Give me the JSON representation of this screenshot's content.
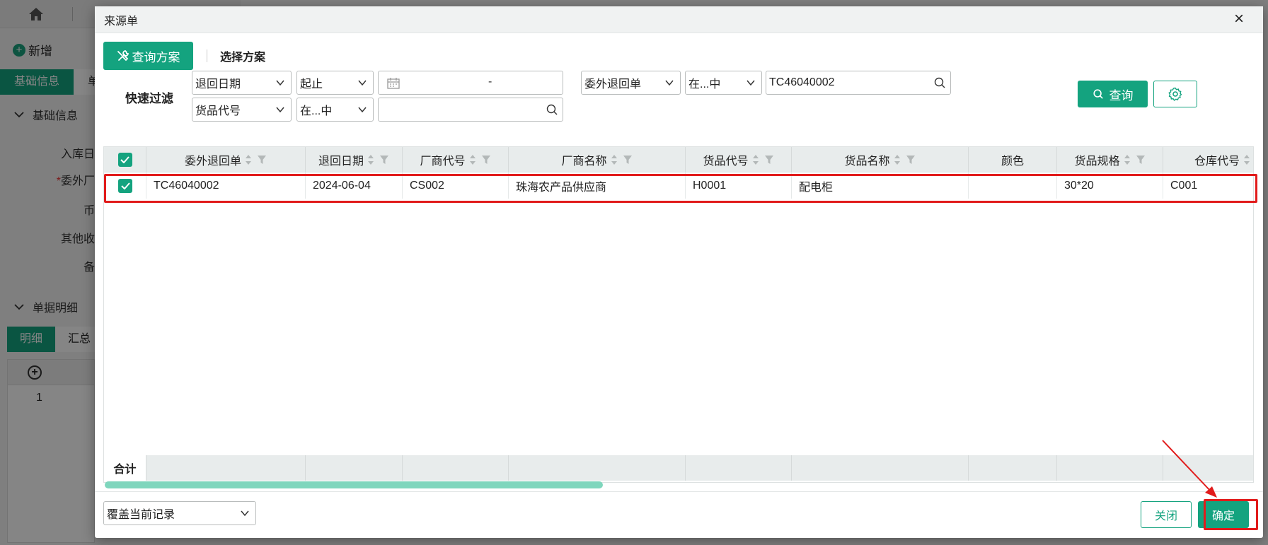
{
  "background": {
    "toolbar": {
      "add_label": "新增"
    },
    "tabs": [
      "基础信息",
      "单"
    ],
    "section_basic": "基础信息",
    "labels": [
      "入库日",
      "委外厂",
      "币",
      "其他收",
      "备"
    ],
    "section_detail": "单据明细",
    "subtabs": [
      "明细",
      "汇总"
    ],
    "grid_row_number": "1"
  },
  "modal": {
    "title": "来源单",
    "scheme_button": "查询方案",
    "scheme_select": "选择方案",
    "filter": {
      "title": "快速过滤",
      "row1": {
        "field1": "退回日期",
        "op1": "起止",
        "date_separator": "-",
        "field2": "委外退回单",
        "op2": "在...中",
        "value2": "TC46040002"
      },
      "row2": {
        "field1": "货品代号",
        "op1": "在...中",
        "value1": ""
      }
    },
    "query_button": "查询",
    "grid": {
      "columns": [
        "委外退回单",
        "退回日期",
        "厂商代号",
        "厂商名称",
        "货品代号",
        "货品名称",
        "颜色",
        "货品规格",
        "仓库代号"
      ],
      "rows": [
        [
          "TC46040002",
          "2024-06-04",
          "CS002",
          "珠海农产品供应商",
          "H0001",
          "配电柜",
          "",
          "30*20",
          "C001"
        ]
      ],
      "total_label": "合计"
    },
    "footer": {
      "mode_select": "覆盖当前记录",
      "close_button": "关闭",
      "ok_button": "确定"
    }
  },
  "colors": {
    "accent": "#14a37f",
    "annotation": "#e11b1b"
  }
}
